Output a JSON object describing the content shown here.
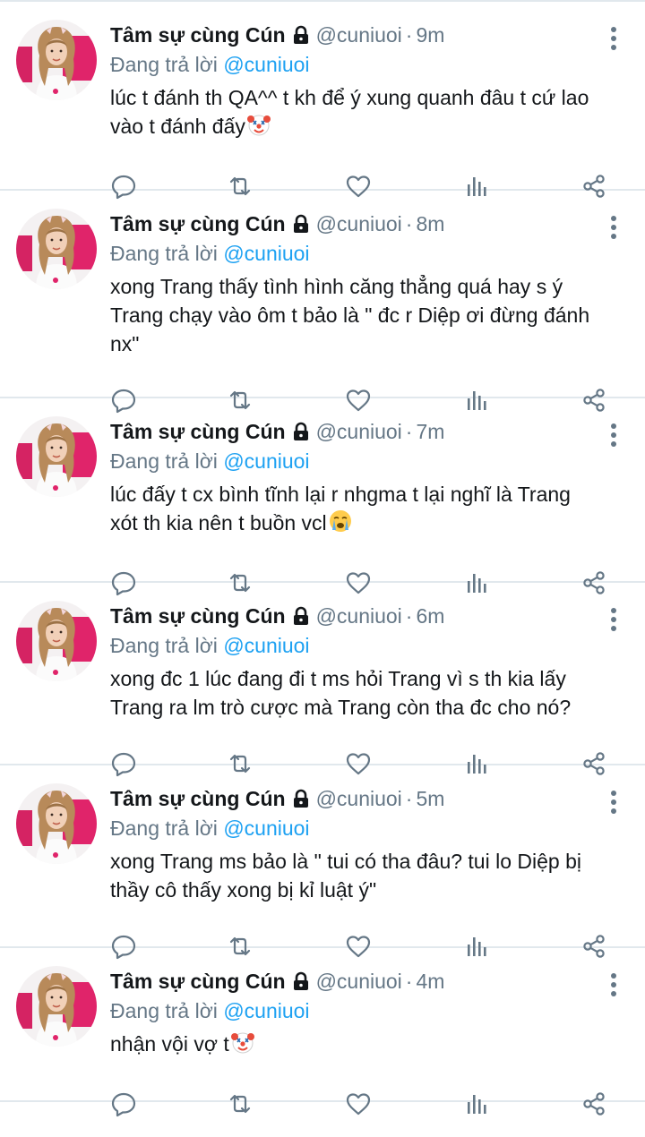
{
  "tweets": [
    {
      "display_name": "Tâm sự cùng Cún",
      "handle": "@cuniuoi",
      "time": "9m",
      "reply_prefix": "Đang trả lời",
      "reply_to": "@cuniuoi",
      "text": "lúc t đánh th QA^^ t kh để ý xung quanh đâu t cứ lao vào t đánh đấy",
      "emoji": "clown-face-icon"
    },
    {
      "display_name": "Tâm sự cùng Cún",
      "handle": "@cuniuoi",
      "time": "8m",
      "reply_prefix": "Đang trả lời",
      "reply_to": "@cuniuoi",
      "text": "xong Trang thấy tình hình căng thẳng quá hay s ý Trang chạy vào ôm t bảo là \" đc r Diệp ơi đừng đánh nx\"",
      "emoji": ""
    },
    {
      "display_name": "Tâm sự cùng Cún",
      "handle": "@cuniuoi",
      "time": "7m",
      "reply_prefix": "Đang trả lời",
      "reply_to": "@cuniuoi",
      "text": "lúc đấy t cx bình tĩnh lại r nhgma t lại nghĩ là Trang xót th kia nên t buồn vcl",
      "emoji": "crying-face-icon"
    },
    {
      "display_name": "Tâm sự cùng Cún",
      "handle": "@cuniuoi",
      "time": "6m",
      "reply_prefix": "Đang trả lời",
      "reply_to": "@cuniuoi",
      "text": "xong đc 1 lúc đang đi t ms hỏi Trang vì s th kia lấy Trang ra lm trò cược mà Trang còn tha đc cho nó?",
      "emoji": ""
    },
    {
      "display_name": "Tâm sự cùng Cún",
      "handle": "@cuniuoi",
      "time": "5m",
      "reply_prefix": "Đang trả lời",
      "reply_to": "@cuniuoi",
      "text": "xong Trang ms bảo là \" tui có tha đâu? tui lo Diệp bị thầy cô thấy xong bị kỉ luật ý\"",
      "emoji": ""
    },
    {
      "display_name": "Tâm sự cùng Cún",
      "handle": "@cuniuoi",
      "time": "4m",
      "reply_prefix": "Đang trả lời",
      "reply_to": "@cuniuoi",
      "text": "nhận vội vợ t",
      "emoji": "clown-face-icon"
    }
  ],
  "colors": {
    "text": "#14171a",
    "muted": "#657786",
    "link": "#1da1f2",
    "divider": "#e1e8ed",
    "icon": "#657786"
  },
  "action_icons": [
    "reply-icon",
    "retweet-icon",
    "like-icon",
    "analytics-icon",
    "share-icon"
  ]
}
